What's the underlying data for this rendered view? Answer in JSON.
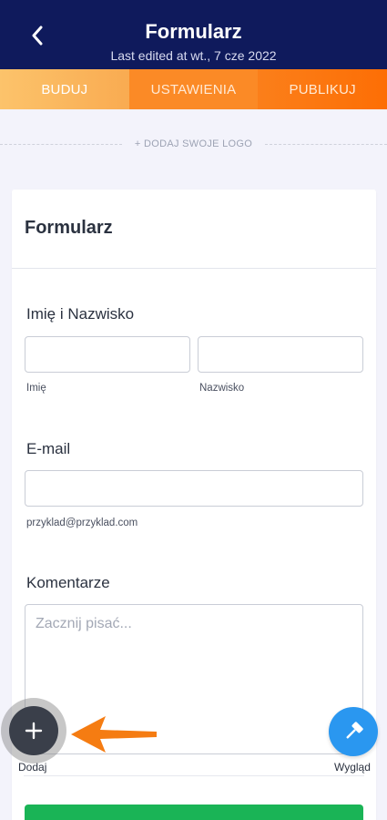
{
  "header": {
    "title": "Formularz",
    "subtitle": "Last edited at wt., 7 cze 2022",
    "back_icon": "chevron-left-icon",
    "background": "#0f1a5c"
  },
  "tabs": [
    {
      "label": "BUDUJ",
      "active": true
    },
    {
      "label": "USTAWIENIA",
      "active": false
    },
    {
      "label": "PUBLIKUJ",
      "active": false
    }
  ],
  "logo": {
    "label": "+ DODAJ SWOJE LOGO"
  },
  "form": {
    "title": "Formularz",
    "name_field": {
      "label": "Imię i Nazwisko",
      "first_value": "",
      "last_value": "",
      "first_sublabel": "Imię",
      "last_sublabel": "Nazwisko"
    },
    "email_field": {
      "label": "E-mail",
      "value": "",
      "sublabel": "przyklad@przyklad.com"
    },
    "comments_field": {
      "label": "Komentarze",
      "placeholder": "Zacznij pisać..."
    },
    "submit_color": "#1ab456"
  },
  "fabs": {
    "add_label": "Dodaj",
    "add_icon": "plus-icon",
    "style_label": "Wygląd",
    "style_icon": "paint-roller-icon",
    "style_color": "#2a97f0",
    "pointer_icon": "arrow-left-icon",
    "pointer_color": "#f57c12"
  }
}
